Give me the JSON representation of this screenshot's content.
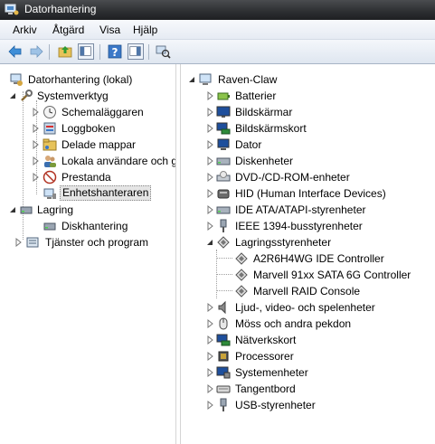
{
  "window": {
    "title": "Datorhantering"
  },
  "menu": [
    "Arkiv",
    "Åtgärd",
    "Visa",
    "Hjälp"
  ],
  "toolbar": [
    "back-arrow-icon",
    "forward-arrow-icon",
    "console-tree-icon",
    "up-folder-icon",
    "properties-icon",
    "help-icon",
    "show-hide-icon",
    "scan-hardware-icon"
  ],
  "left_tree": {
    "root": "Datorhantering (lokal)",
    "systemverktyg": "Systemverktyg",
    "schemalaggaren": "Schemaläggaren",
    "loggboken": "Loggboken",
    "delade_mappar": "Delade mappar",
    "lokala": "Lokala användare och g",
    "prestanda": "Prestanda",
    "enhetshanteraren": "Enhetshanteraren",
    "lagring": "Lagring",
    "diskhantering": "Diskhantering",
    "tjanster": "Tjänster och program"
  },
  "right_tree": {
    "root": "Raven-Claw",
    "items": [
      "Batterier",
      "Bildskärmar",
      "Bildskärmskort",
      "Dator",
      "Diskenheter",
      "DVD-/CD-ROM-enheter",
      "HID (Human Interface Devices)",
      "IDE ATA/ATAPI-styrenheter",
      "IEEE 1394-busstyrenheter",
      "Lagringsstyrenheter",
      "A2R6H4WG IDE Controller",
      "Marvell 91xx SATA 6G Controller",
      "Marvell RAID Console",
      "Ljud-, video- och spelenheter",
      "Möss och andra pekdon",
      "Nätverkskort",
      "Processorer",
      "Systemenheter",
      "Tangentbord",
      "USB-styrenheter"
    ]
  },
  "colors": {
    "title_bar": "#2e3033",
    "selection": "#e5e5e5"
  }
}
